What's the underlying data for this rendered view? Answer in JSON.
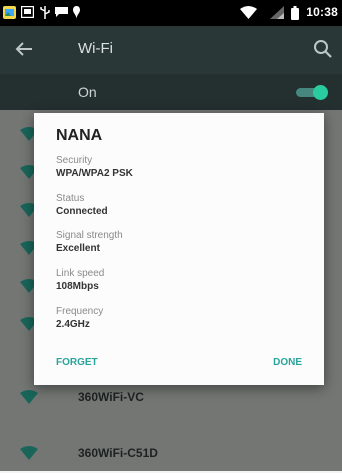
{
  "status_bar": {
    "time": "10:38"
  },
  "app_bar": {
    "title": "Wi-Fi"
  },
  "switch_bar": {
    "label": "On",
    "enabled": true
  },
  "networks": [
    {
      "name": ""
    },
    {
      "name": ""
    },
    {
      "name": ""
    },
    {
      "name": ""
    },
    {
      "name": ""
    },
    {
      "name": ""
    },
    {
      "name": "360WiFi-VC"
    },
    {
      "name": "360WiFi-C51D"
    }
  ],
  "dialog": {
    "title": "NANA",
    "fields": [
      {
        "label": "Security",
        "value": "WPA/WPA2 PSK"
      },
      {
        "label": "Status",
        "value": "Connected"
      },
      {
        "label": "Signal strength",
        "value": "Excellent"
      },
      {
        "label": "Link speed",
        "value": "108Mbps"
      },
      {
        "label": "Frequency",
        "value": "2.4GHz"
      }
    ],
    "forget_label": "FORGET",
    "done_label": "DONE"
  },
  "colors": {
    "accent": "#2aa39a",
    "toolbar": "#2c3a3a",
    "wifi_icon": "#1b6b5f"
  },
  "icons": {
    "status": [
      "gallery-icon",
      "image-icon",
      "usb-icon",
      "message-icon",
      "notification-icon",
      "wifi-icon",
      "signal-icon",
      "battery-icon"
    ],
    "app_bar": [
      "back-arrow-icon",
      "search-icon"
    ],
    "network": "wifi-signal-icon"
  }
}
